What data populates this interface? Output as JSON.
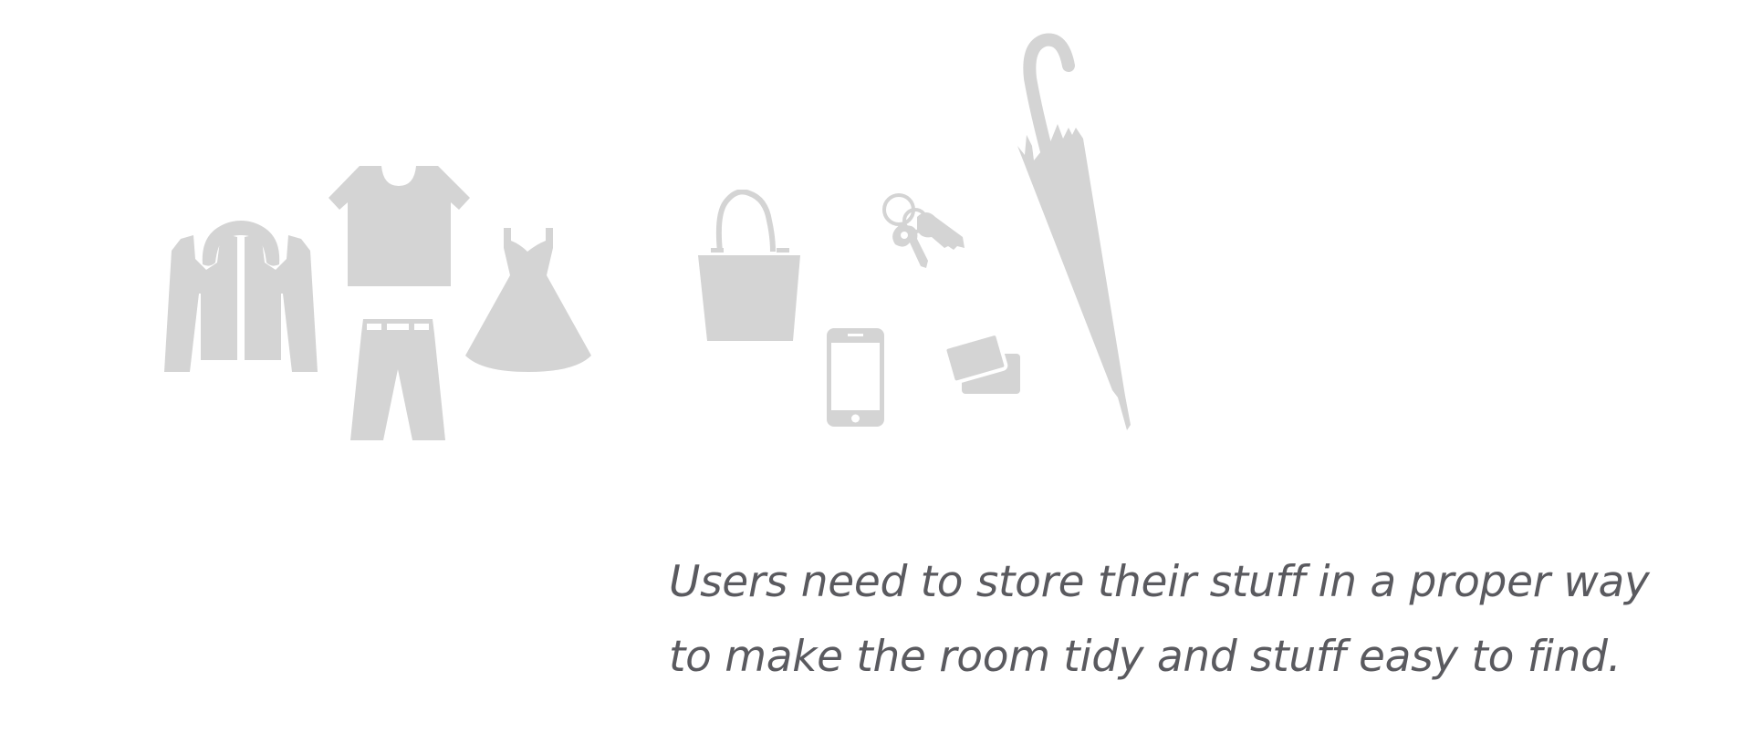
{
  "theme": {
    "icon_color": "#d4d4d4",
    "text_color": "#5a5a5f",
    "background": "#ffffff"
  },
  "icons": [
    "jacket-icon",
    "tshirt-icon",
    "pants-icon",
    "dress-icon",
    "handbag-icon",
    "keys-icon",
    "smartphone-icon",
    "cards-icon",
    "umbrella-icon"
  ],
  "caption": {
    "line1": "Users need to store their stuff in a proper way",
    "line2": "to make the room tidy and stuff easy to find."
  }
}
